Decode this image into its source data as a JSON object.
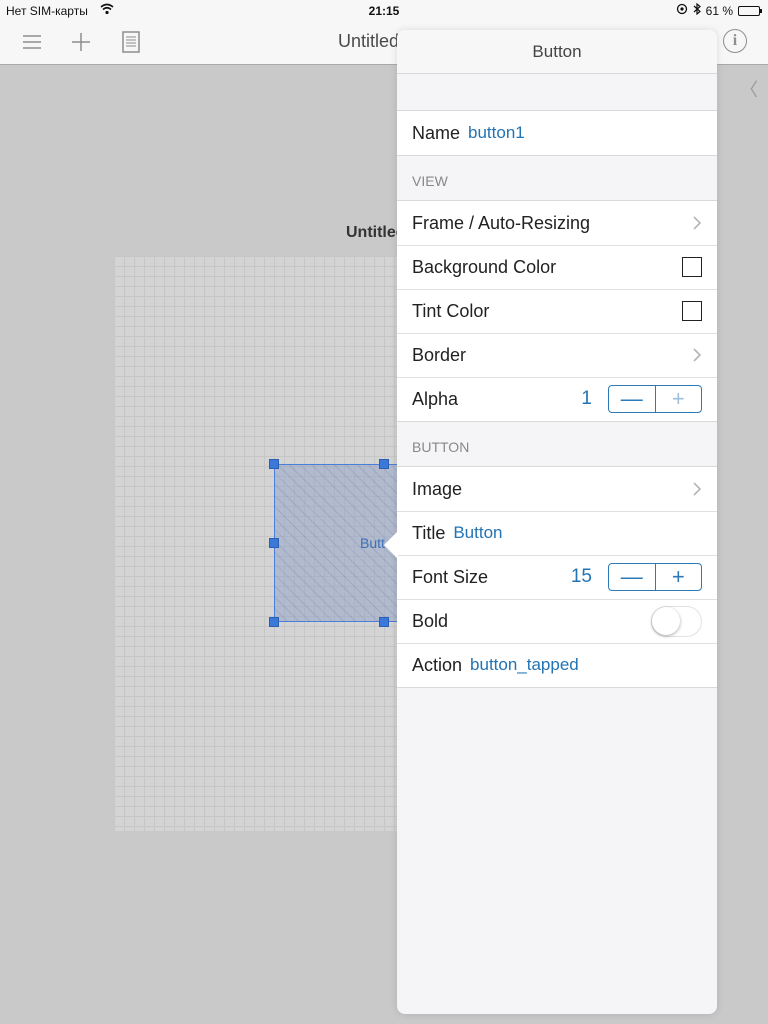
{
  "status_bar": {
    "carrier": "Нет SIM-карты",
    "time": "21:15",
    "battery": "61 %",
    "battery_level": 0.61
  },
  "navbar": {
    "title": "Untitled",
    "tools": [
      "list-icon",
      "plus-icon",
      "document-icon"
    ],
    "info_glyph": "i"
  },
  "canvas": {
    "doc_caption": "Untitled",
    "button_label": "Butt"
  },
  "panel": {
    "header": "Button",
    "name": {
      "label": "Name",
      "value": "button1"
    },
    "view_section": {
      "title": "VIEW",
      "frame_label": "Frame / Auto-Resizing",
      "bg_color_label": "Background Color",
      "tint_color_label": "Tint Color",
      "border_label": "Border",
      "alpha_label": "Alpha",
      "alpha_value": "1"
    },
    "button_section": {
      "title": "BUTTON",
      "image_label": "Image",
      "title_label": "Title",
      "title_value": "Button",
      "font_size_label": "Font Size",
      "font_size_value": "15",
      "bold_label": "Bold",
      "bold_on": false,
      "action_label": "Action",
      "action_value": "button_tapped"
    },
    "stepper": {
      "minus": "—",
      "plus": "+"
    }
  },
  "colors": {
    "accent": "#2274b5",
    "selection": "#3c78d8",
    "background": "#c9c9c9"
  }
}
